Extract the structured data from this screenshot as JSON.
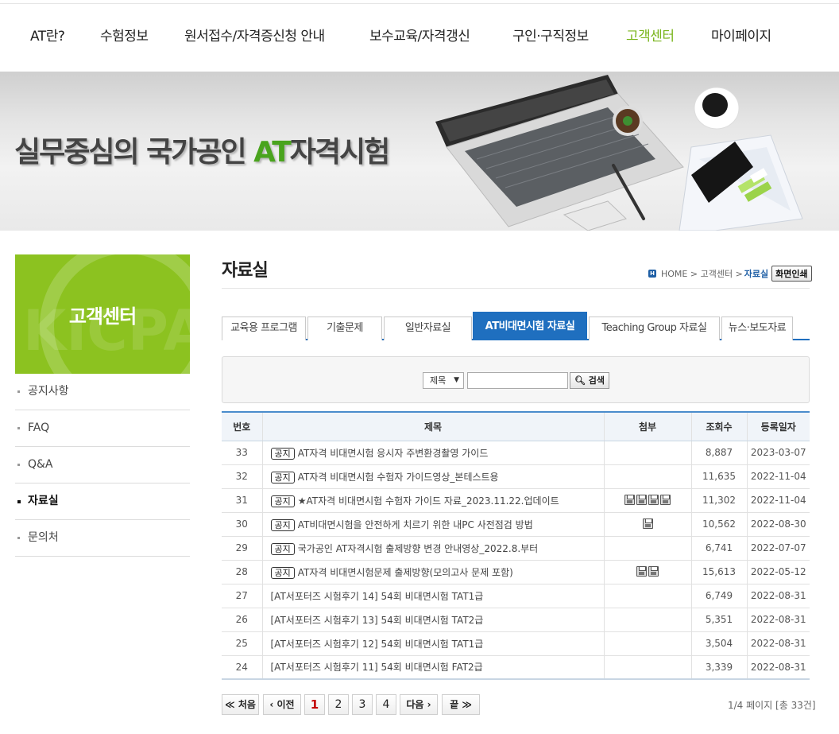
{
  "gnb": [
    {
      "label": "AT란?"
    },
    {
      "label": "수험정보"
    },
    {
      "label": "원서접수/자격증신청 안내"
    },
    {
      "label": "보수교육/자격갱신"
    },
    {
      "label": "구인·구직정보"
    },
    {
      "label": "고객센터"
    },
    {
      "label": "마이페이지"
    }
  ],
  "banner": {
    "title_pre": "실무중심의 국가공인 ",
    "title_hl": "AT",
    "title_post": "자격시험"
  },
  "sidebar": {
    "title": "고객센터",
    "items": [
      {
        "label": "공지사항"
      },
      {
        "label": "FAQ"
      },
      {
        "label": "Q&A"
      },
      {
        "label": "자료실"
      },
      {
        "label": "문의처"
      }
    ]
  },
  "page": {
    "title": "자료실"
  },
  "location": {
    "home": "HOME",
    "sep": ">",
    "level1": "고객센터",
    "current": "자료실",
    "print_label": "화면인쇄",
    "home_icon": "H"
  },
  "tabs": [
    {
      "label": "교육용 프로그램"
    },
    {
      "label": "기출문제"
    },
    {
      "label": "일반자료실"
    },
    {
      "label": "AT비대면시험 자료실"
    },
    {
      "label": "Teaching Group 자료실"
    },
    {
      "label": "뉴스·보도자료"
    }
  ],
  "search": {
    "selected": "제목",
    "value": "",
    "button_label": "검색"
  },
  "table": {
    "headers": [
      "번호",
      "제목",
      "첨부",
      "조회수",
      "등록일자"
    ],
    "notice_label": "공지",
    "rows": [
      {
        "no": "33",
        "notice": true,
        "title": "AT자격 비대면시험 응시자 주변환경촬영 가이드",
        "files": 0,
        "views": "8,887",
        "date": "2023-03-07"
      },
      {
        "no": "32",
        "notice": true,
        "title": "AT자격 비대면시험 수험자 가이드영상_본테스트용",
        "files": 0,
        "views": "11,635",
        "date": "2022-11-04"
      },
      {
        "no": "31",
        "notice": true,
        "title": "★AT자격 비대면시험 수험자 가이드 자료_2023.11.22.업데이트",
        "files": 4,
        "views": "11,302",
        "date": "2022-11-04"
      },
      {
        "no": "30",
        "notice": true,
        "title": "AT비대면시험을 안전하게 치르기 위한 내PC 사전점검 방법",
        "files": 1,
        "views": "10,562",
        "date": "2022-08-30"
      },
      {
        "no": "29",
        "notice": true,
        "title": "국가공인 AT자격시험 출제방향 변경 안내영상_2022.8.부터",
        "files": 0,
        "views": "6,741",
        "date": "2022-07-07"
      },
      {
        "no": "28",
        "notice": true,
        "title": "AT자격 비대면시험문제 출제방향(모의고사 문제 포함)",
        "files": 2,
        "views": "15,613",
        "date": "2022-05-12"
      },
      {
        "no": "27",
        "notice": false,
        "title": "[AT서포터즈 시험후기 14] 54회 비대면시험 TAT1급",
        "files": 0,
        "views": "6,749",
        "date": "2022-08-31"
      },
      {
        "no": "26",
        "notice": false,
        "title": "[AT서포터즈 시험후기 13] 54회 비대면시험 TAT2급",
        "files": 0,
        "views": "5,351",
        "date": "2022-08-31"
      },
      {
        "no": "25",
        "notice": false,
        "title": "[AT서포터즈 시험후기 12] 54회 비대면시험 TAT1급",
        "files": 0,
        "views": "3,504",
        "date": "2022-08-31"
      },
      {
        "no": "24",
        "notice": false,
        "title": "[AT서포터즈 시험후기 11] 54회 비대면시험 FAT2급",
        "files": 0,
        "views": "3,339",
        "date": "2022-08-31"
      }
    ]
  },
  "paging": {
    "first": "≪ 처음",
    "prev": "‹ 이전",
    "pages": [
      "1",
      "2",
      "3",
      "4"
    ],
    "next": "다음 ›",
    "last": "끝 ≫",
    "info": "1/4 페이지 [총 33건]"
  },
  "colors": {
    "accent_green": "#7ab51d",
    "tab_blue": "#1f6fbf",
    "sidebar_green": "#8cc220",
    "current_page": "#c40000"
  }
}
